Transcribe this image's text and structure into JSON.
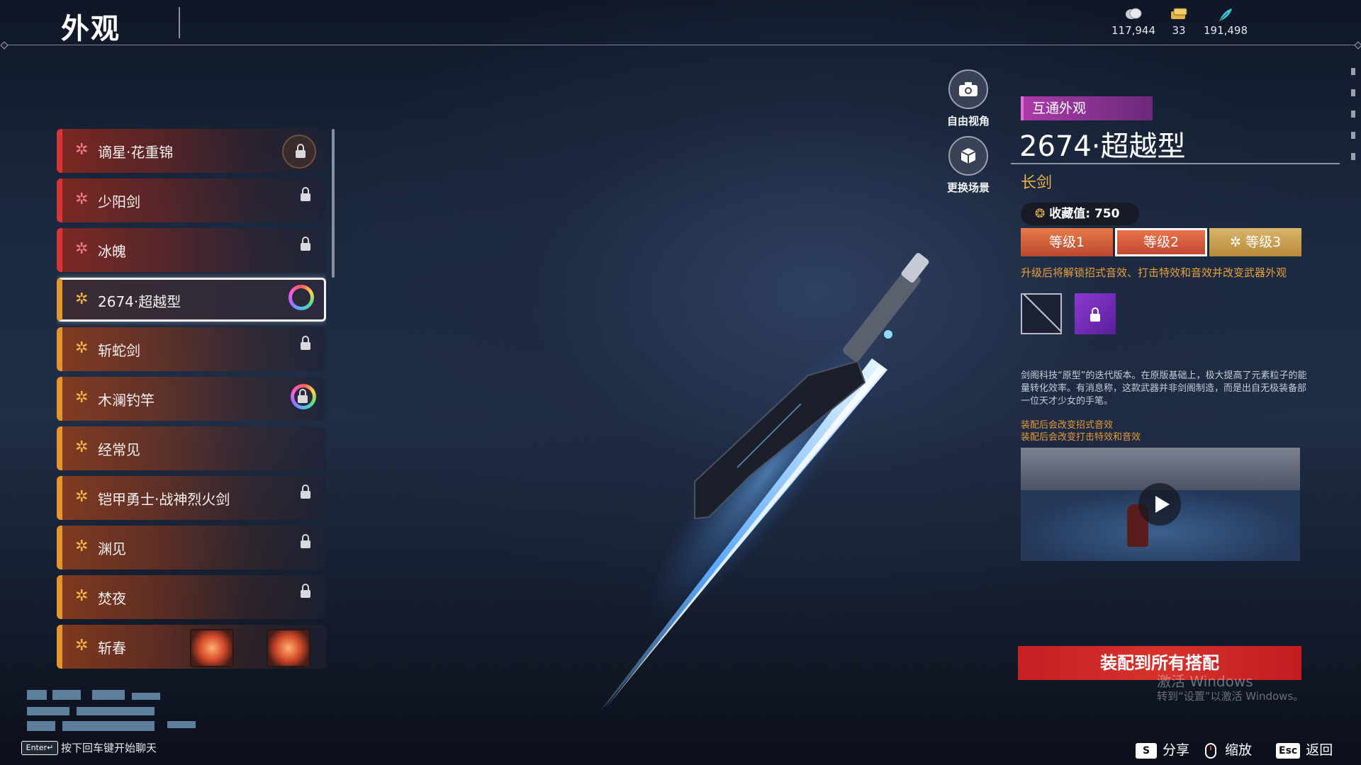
{
  "header": {
    "title": "外观",
    "currencies": [
      {
        "icon": "coin-icon",
        "value": "117,944"
      },
      {
        "icon": "ticket-icon",
        "value": "33"
      },
      {
        "icon": "feather-icon",
        "value": "191,498"
      }
    ]
  },
  "list": {
    "items": [
      {
        "label": "谪星·花重锦",
        "rarity": "red",
        "status": "round-badge-locked"
      },
      {
        "label": "少阳剑",
        "rarity": "red",
        "status": "locked"
      },
      {
        "label": "冰魄",
        "rarity": "red",
        "status": "locked"
      },
      {
        "label": "2674·超越型",
        "rarity": "gold",
        "status": "selected-ring"
      },
      {
        "label": "斩蛇剑",
        "rarity": "gold",
        "status": "locked"
      },
      {
        "label": "木澜钓竿",
        "rarity": "gold",
        "status": "ring-locked"
      },
      {
        "label": "经常见",
        "rarity": "gold",
        "status": "none"
      },
      {
        "label": "铠甲勇士·战神烈火剑",
        "rarity": "gold",
        "status": "locked"
      },
      {
        "label": "渊见",
        "rarity": "gold",
        "status": "locked"
      },
      {
        "label": "焚夜",
        "rarity": "gold",
        "status": "locked"
      },
      {
        "label": "斩春",
        "rarity": "gold",
        "status": "lantern"
      }
    ]
  },
  "view_controls": {
    "free_view": "自由视角",
    "change_scene": "更换场景"
  },
  "detail": {
    "tag": "互通外观",
    "name": "2674·超越型",
    "weapon_type": "长剑",
    "collect_label": "收藏值: 750",
    "levels": [
      "等级1",
      "等级2",
      "等级3"
    ],
    "selected_level": 2,
    "unlock_hint": "升级后将解锁招式音效、打击特效和音效并改变武器外观",
    "description": "剑阁科技“原型”的迭代版本。在原版基础上，极大提高了元素粒子的能量转化效率。有消息称，这款武器并非剑阁制造，而是出自无极装备部一位天才少女的手笔。",
    "effect_1": "装配后会改变招式音效",
    "effect_2": "装配后会改变打击特效和音效",
    "equip_button": "装配到所有搭配"
  },
  "watermark": {
    "line1": "激活 Windows",
    "line2": "转到“设置”以激活 Windows。"
  },
  "footer": {
    "enter_key": "Enter↵",
    "chat_hint": "按下回车键开始聊天",
    "share_key": "S",
    "share_label": "分享",
    "zoom_label": "缩放",
    "back_key": "Esc",
    "back_label": "返回"
  },
  "colors": {
    "accent_red": "#d6322c",
    "rarity_red": "#d8353a",
    "rarity_gold": "#e3962f",
    "tag_purple": "#a93aa8",
    "weapon_type": "#e6b24a"
  }
}
